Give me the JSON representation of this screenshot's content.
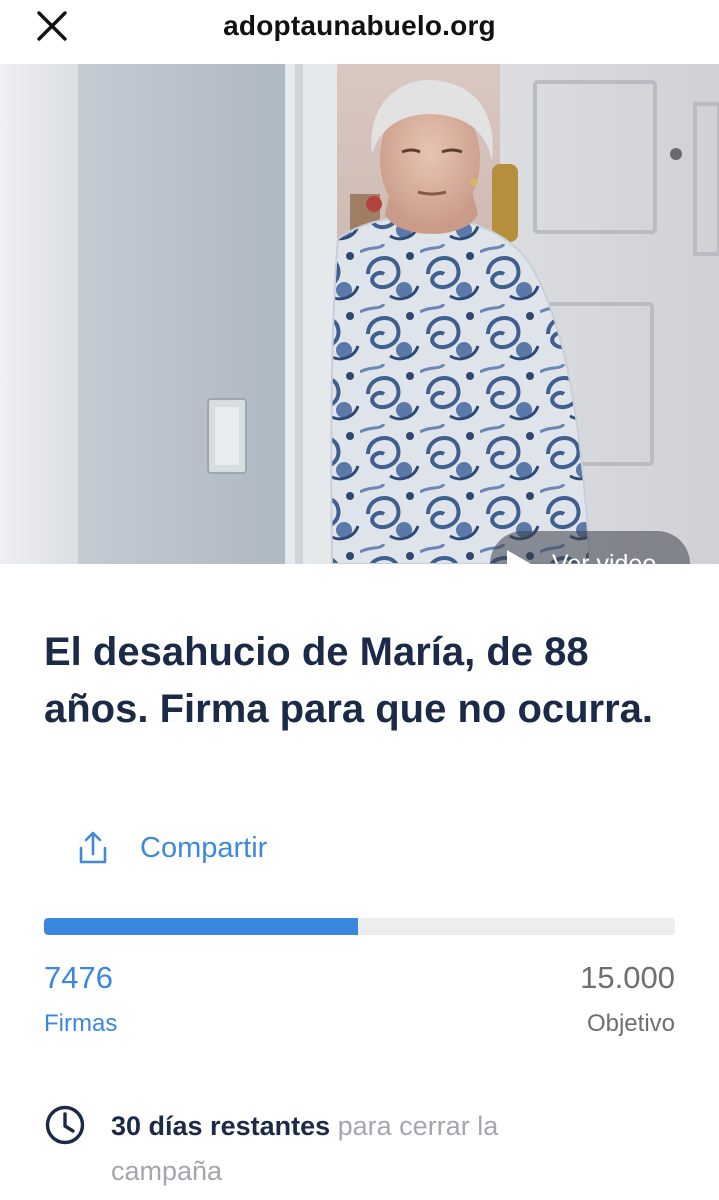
{
  "topbar": {
    "site": "adoptaunabuelo.org",
    "close_icon": "close-icon"
  },
  "hero": {
    "video_label": "Ver video",
    "play_icon": "play-icon"
  },
  "petition": {
    "title": "El desahucio de María, de 88 años. Firma para que no ocurra.",
    "share_label": "Compartir",
    "share_icon": "share-icon",
    "progress_fraction": 0.498,
    "signatures": "7476",
    "signatures_label": "Firmas",
    "goal": "15.000",
    "goal_label": "Objetivo",
    "remaining_strong": "30 días restantes",
    "remaining_rest": "para cerrar la campaña",
    "clock_icon": "clock-icon"
  },
  "colors": {
    "accent": "#3b87df",
    "title": "#1b2a47",
    "muted": "#a3a7ad"
  }
}
